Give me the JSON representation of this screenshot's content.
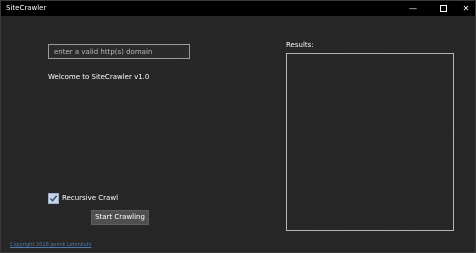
{
  "app": {
    "title": "SiteCrawler"
  },
  "window_controls": {
    "minimize_glyph": "—",
    "close_glyph": "✕"
  },
  "form": {
    "domain_placeholder": "enter a valid http(s) domain",
    "domain_value": "",
    "welcome_text": "Welcome to SiteCrawler v1.0",
    "recursive_label": "Recursive Crawl",
    "recursive_checked": true,
    "start_button_label": "Start Crawling"
  },
  "results": {
    "label": "Results:",
    "items": []
  },
  "footer": {
    "copyright": "Copyright 2018 Jannik Lehmkuhl"
  },
  "colors": {
    "titlebar": "#000000",
    "background": "#262626",
    "checkbox": "#c8d4e6",
    "link": "#4e79ad"
  }
}
